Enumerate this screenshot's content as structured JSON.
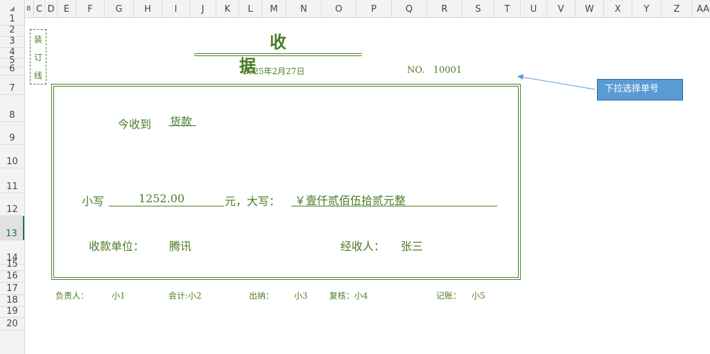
{
  "columns": [
    "B",
    "C",
    "D",
    "E",
    "F",
    "G",
    "H",
    "I",
    "J",
    "K",
    "L",
    "M",
    "N",
    "O",
    "P",
    "Q",
    "R",
    "S",
    "T",
    "U",
    "V",
    "W",
    "X",
    "Y",
    "Z",
    "AA"
  ],
  "rows": [
    "1",
    "2",
    "3",
    "4",
    "5",
    "6",
    "7",
    "8",
    "9",
    "10",
    "11",
    "12",
    "13",
    "14",
    "15",
    "16",
    "17",
    "18",
    "19",
    "20"
  ],
  "selected_row": "13",
  "receipt": {
    "binding_chars": [
      "装",
      "订",
      "线"
    ],
    "title": "收据",
    "date": "2025年2月27日",
    "no_label": "NO.",
    "no_value": "10001",
    "received_from_label": "今收到",
    "received_from_value": "货款",
    "lowercase_label": "小写",
    "amount_lower": "1252.00",
    "yuan_uppercase_label": "元，大写：",
    "amount_upper": "￥壹仟贰佰伍拾贰元整",
    "payee_unit_label": "收款单位：",
    "payee_unit_value": "腾讯",
    "handler_label": "经收人：",
    "handler_value": "张三"
  },
  "footer": {
    "responsible_label": "负责人：",
    "responsible_value": "小1",
    "accountant_label": "会计:",
    "accountant_value": "小2",
    "cashier_label": "出纳：",
    "cashier_value": "小3",
    "reviewer_label": "复核：",
    "reviewer_value": "小4",
    "bookkeeper_label": "记账：",
    "bookkeeper_value": "小5"
  },
  "callout": {
    "text": "下拉选择单号"
  },
  "colors": {
    "receipt_green": "#4a7a24",
    "callout_fill": "#5b9bd5",
    "arrow": "#5b9bd5"
  }
}
